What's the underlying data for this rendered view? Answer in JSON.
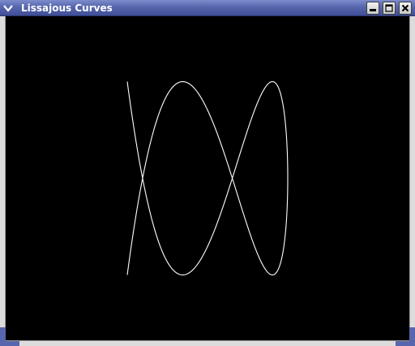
{
  "window": {
    "title": "Lissajous Curves",
    "titlebar_color": "#5766ad",
    "canvas_background": "#000000",
    "curve_color": "#ffffff"
  },
  "controls": {
    "menu_icon": "chevron-down-icon",
    "minimize_icon": "minimize-icon",
    "maximize_icon": "maximize-icon",
    "close_icon": "close-icon"
  }
}
